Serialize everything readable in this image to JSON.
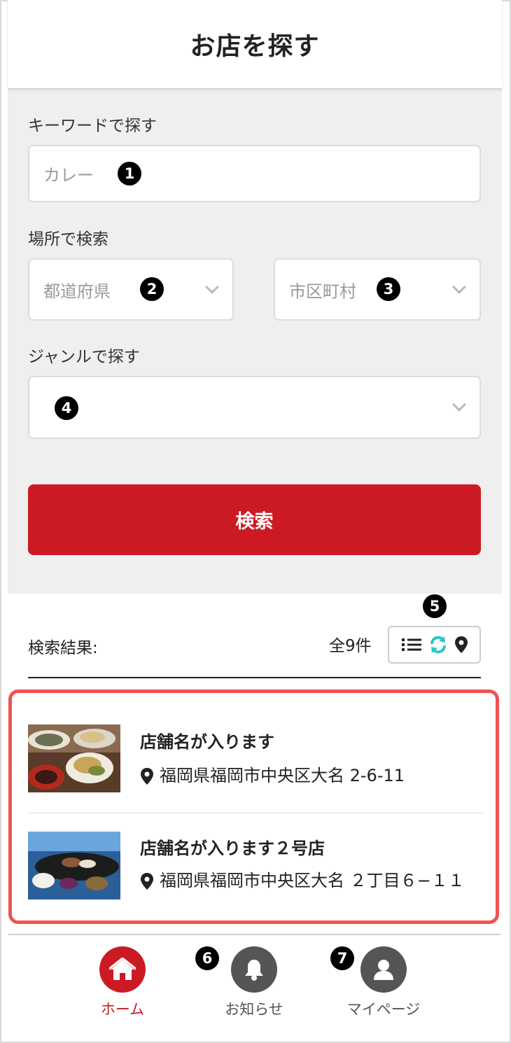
{
  "header": {
    "title": "お店を探す"
  },
  "search": {
    "keyword_label": "キーワードで探す",
    "keyword_placeholder": "カレー",
    "location_label": "場所で検索",
    "prefecture_placeholder": "都道府県",
    "city_placeholder": "市区町村",
    "genre_label": "ジャンルで探す",
    "genre_value": "",
    "submit_label": "検索"
  },
  "markers": [
    "1",
    "2",
    "3",
    "4",
    "5",
    "6",
    "7"
  ],
  "results": {
    "label": "検索結果:",
    "count": "全9件",
    "view_icons": [
      "list-icon",
      "refresh-icon",
      "map-pin-icon"
    ],
    "items": [
      {
        "name": "店舗名が入ります",
        "address": "福岡県福岡市中央区大名 2-6-11"
      },
      {
        "name": "店舗名が入ります２号店",
        "address": "福岡県福岡市中央区大名 ２丁目６−１１"
      }
    ]
  },
  "nav": {
    "items": [
      {
        "label": "ホーム",
        "icon": "home-icon",
        "active": true
      },
      {
        "label": "お知らせ",
        "icon": "bell-icon",
        "active": false
      },
      {
        "label": "マイページ",
        "icon": "user-icon",
        "active": false
      }
    ]
  },
  "colors": {
    "accent": "#cc1a24",
    "highlight": "#ef5350",
    "refresh": "#2ec4c4",
    "inactive": "#555555"
  }
}
